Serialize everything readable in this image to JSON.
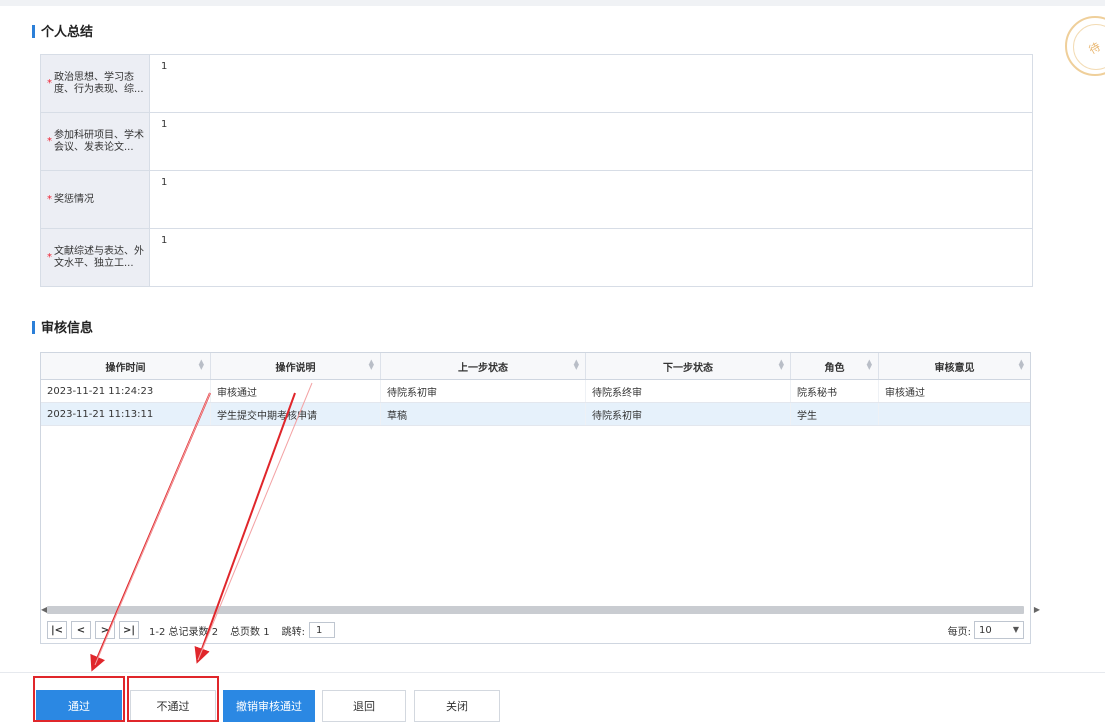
{
  "summary": {
    "title": "个人总结",
    "rows": [
      {
        "label": "政治思想、学习态度、行为表现、综...",
        "value": "1"
      },
      {
        "label": "参加科研项目、学术会议、发表论文...",
        "value": "1"
      },
      {
        "label": "奖惩情况",
        "value": "1"
      },
      {
        "label": "文献综述与表达、外文水平、独立工...",
        "value": "1"
      }
    ]
  },
  "review": {
    "title": "审核信息",
    "columns": [
      "操作时间",
      "操作说明",
      "上一步状态",
      "下一步状态",
      "角色",
      "审核意见"
    ],
    "rows": [
      [
        "2023-11-21 11:24:23",
        "审核通过",
        "待院系初审",
        "待院系终审",
        "院系秘书",
        "审核通过"
      ],
      [
        "2023-11-21 11:13:11",
        "学生提交中期考核申请",
        "草稿",
        "待院系初审",
        "学生",
        ""
      ]
    ],
    "pager": {
      "first": "|<",
      "prev": "<",
      "next": ">",
      "last": ">|",
      "info": "1-2 总记录数 2",
      "pages": "总页数 1",
      "jump_label": "跳转:",
      "jump_value": "1",
      "per_page_label": "每页:",
      "per_page_value": "10"
    }
  },
  "buttons": {
    "approve": "通过",
    "reject": "不通过",
    "revoke": "撤销审核通过",
    "return": "退回",
    "close": "关闭"
  },
  "stamp": {
    "text": "待"
  },
  "colors": {
    "primary": "#2b88e3",
    "annotation": "#e0262b",
    "required": "#ee2233"
  }
}
